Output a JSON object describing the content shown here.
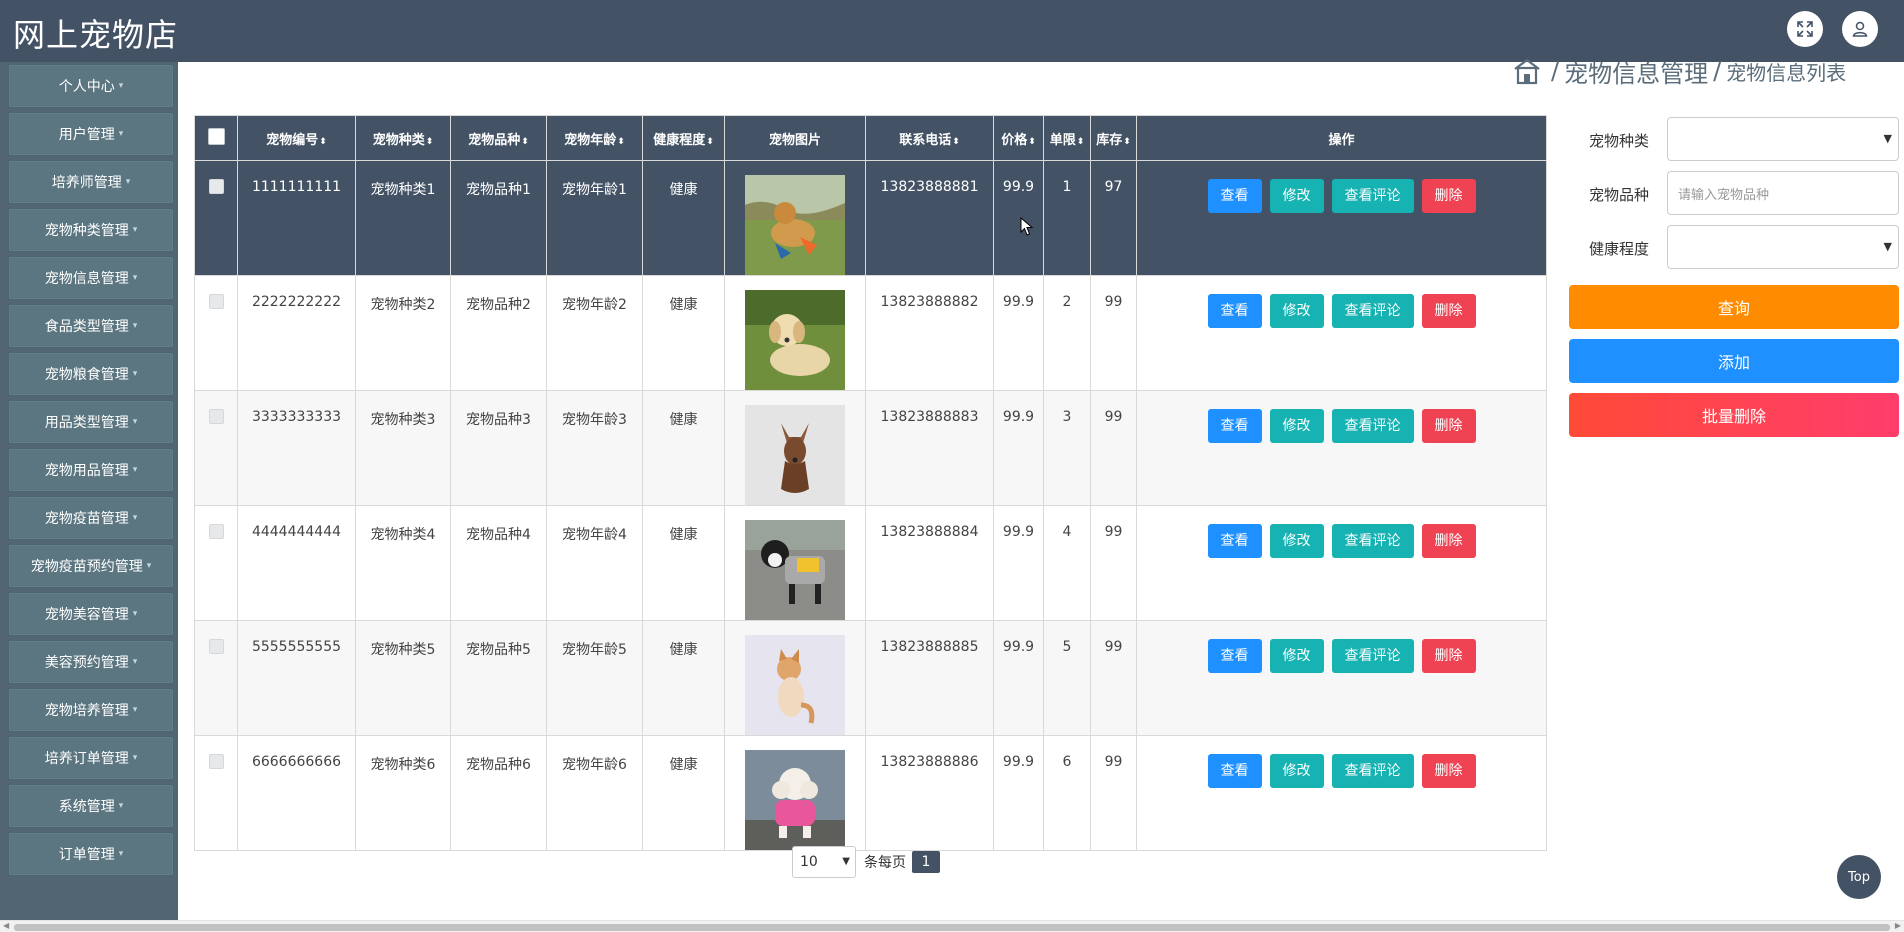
{
  "app": {
    "title": "网上宠物店"
  },
  "header_icons": [
    "fullscreen-icon",
    "user-icon"
  ],
  "sidebar": {
    "items": [
      {
        "label": "个人中心"
      },
      {
        "label": "用户管理"
      },
      {
        "label": "培养师管理"
      },
      {
        "label": "宠物种类管理"
      },
      {
        "label": "宠物信息管理"
      },
      {
        "label": "食品类型管理"
      },
      {
        "label": "宠物粮食管理"
      },
      {
        "label": "用品类型管理"
      },
      {
        "label": "宠物用品管理"
      },
      {
        "label": "宠物疫苗管理"
      },
      {
        "label": "宠物疫苗预约管理"
      },
      {
        "label": "宠物美容管理"
      },
      {
        "label": "美容预约管理"
      },
      {
        "label": "宠物培养管理"
      },
      {
        "label": "培养订单管理"
      },
      {
        "label": "系统管理"
      },
      {
        "label": "订单管理"
      }
    ]
  },
  "breadcrumb": {
    "level1": "宠物信息管理",
    "level2": "宠物信息列表",
    "separator": "/"
  },
  "table": {
    "headers": {
      "id": "宠物编号",
      "kind": "宠物种类",
      "breed": "宠物品种",
      "age": "宠物年龄",
      "health": "健康程度",
      "image": "宠物图片",
      "phone": "联系电话",
      "price": "价格",
      "limit": "单限",
      "stock": "库存",
      "actions": "操作"
    },
    "action_labels": {
      "view": "查看",
      "edit": "修改",
      "comment": "查看评论",
      "delete": "删除"
    },
    "rows": [
      {
        "id": "1111111111",
        "kind": "宠物种类1",
        "breed": "宠物品种1",
        "age": "宠物年龄1",
        "health": "健康",
        "phone": "13823888881",
        "price": "99.9",
        "limit": "1",
        "stock": "97"
      },
      {
        "id": "2222222222",
        "kind": "宠物种类2",
        "breed": "宠物品种2",
        "age": "宠物年龄2",
        "health": "健康",
        "phone": "13823888882",
        "price": "99.9",
        "limit": "2",
        "stock": "99"
      },
      {
        "id": "3333333333",
        "kind": "宠物种类3",
        "breed": "宠物品种3",
        "age": "宠物年龄3",
        "health": "健康",
        "phone": "13823888883",
        "price": "99.9",
        "limit": "3",
        "stock": "99"
      },
      {
        "id": "4444444444",
        "kind": "宠物种类4",
        "breed": "宠物品种4",
        "age": "宠物年龄4",
        "health": "健康",
        "phone": "13823888884",
        "price": "99.9",
        "limit": "4",
        "stock": "99"
      },
      {
        "id": "5555555555",
        "kind": "宠物种类5",
        "breed": "宠物品种5",
        "age": "宠物年龄5",
        "health": "健康",
        "phone": "13823888885",
        "price": "99.9",
        "limit": "5",
        "stock": "99"
      },
      {
        "id": "6666666666",
        "kind": "宠物种类6",
        "breed": "宠物品种6",
        "age": "宠物年龄6",
        "health": "健康",
        "phone": "13823888886",
        "price": "99.9",
        "limit": "6",
        "stock": "99"
      }
    ]
  },
  "search": {
    "kind_label": "宠物种类",
    "kind_value": "",
    "breed_label": "宠物品种",
    "breed_placeholder": "请输入宠物品种",
    "health_label": "健康程度",
    "health_value": "",
    "search_button": "查询",
    "add_button": "添加",
    "batch_delete_button": "批量删除"
  },
  "pagination": {
    "page_size": "10",
    "page_size_suffix": "条每页",
    "current_page": "1"
  },
  "top_button": "Top",
  "colors": {
    "header_bg": "#435365",
    "sidebar_item": "#5b7680",
    "view": "#1e90ff",
    "edit": "#17b2b2",
    "delete": "#ef4252",
    "search": "#ff8c00"
  }
}
